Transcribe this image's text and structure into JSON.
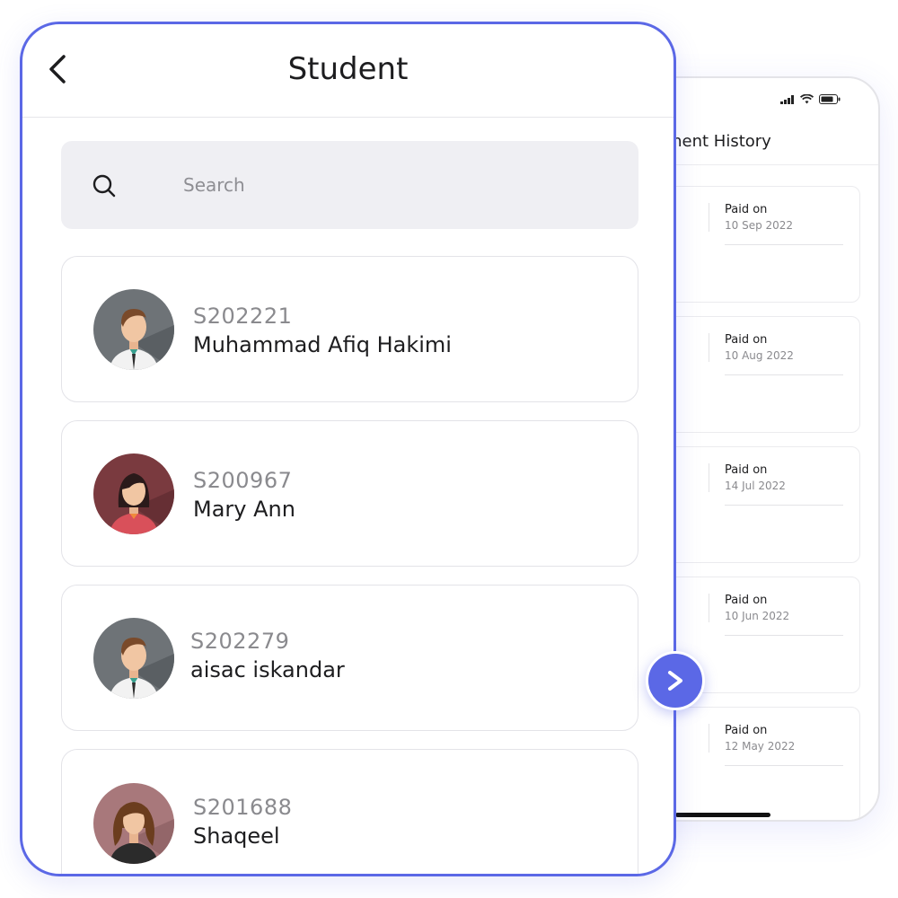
{
  "front": {
    "title": "Student",
    "search": {
      "placeholder": "Search",
      "value": ""
    },
    "students": [
      {
        "id": "S202221",
        "name": "Muhammad Afiq Hakimi",
        "avatar": "male-avatar"
      },
      {
        "id": "S200967",
        "name": "Mary Ann",
        "avatar": "female-avatar"
      },
      {
        "id": "S202279",
        "name": "aisac iskandar",
        "avatar": "male-avatar"
      },
      {
        "id": "S201688",
        "name": "Shaqeel",
        "avatar": "female-curly-avatar"
      }
    ]
  },
  "back": {
    "title": "ment History",
    "payments": [
      {
        "label": "Paid on",
        "date": "10 Sep 2022"
      },
      {
        "label": "Paid on",
        "date": "10 Aug 2022"
      },
      {
        "label": "Paid on",
        "date": "14 Jul 2022"
      },
      {
        "label": "Paid on",
        "date": "10 Jun 2022"
      },
      {
        "label": "Paid on",
        "date": "12 May 2022"
      }
    ]
  },
  "icons": {
    "back": "chevron-left-icon",
    "search": "search-icon",
    "next": "chevron-right-icon",
    "signal": "signal-icon",
    "wifi": "wifi-icon",
    "battery": "battery-icon"
  },
  "colors": {
    "accent": "#5b68e6",
    "text": "#1d1d1f",
    "muted": "#8a8a8e",
    "search_bg": "#efeff3"
  }
}
